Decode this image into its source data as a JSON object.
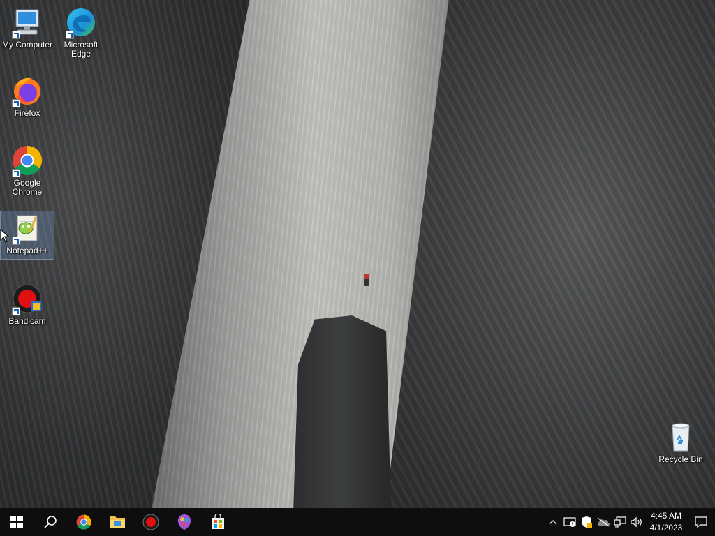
{
  "desktop": {
    "icons": [
      {
        "label": "My Computer"
      },
      {
        "label": "Microsoft Edge"
      },
      {
        "label": "Firefox"
      },
      {
        "label": "Google Chrome"
      },
      {
        "label": "Notepad++"
      },
      {
        "label": "Bandicam"
      },
      {
        "label": "Recycle Bin"
      }
    ]
  },
  "taskbar": {
    "start_icon": "windows-start-icon",
    "pinned": [
      {
        "name": "search-icon"
      },
      {
        "name": "chrome-icon"
      },
      {
        "name": "file-explorer-icon"
      },
      {
        "name": "bandicam-icon"
      },
      {
        "name": "paint-icon"
      },
      {
        "name": "store-icon"
      }
    ],
    "tray": {
      "icons": [
        "chevron-up-icon",
        "security-icon",
        "defender-icon",
        "onedrive-icon",
        "network-icon",
        "volume-icon"
      ],
      "time": "4:45 AM",
      "date": "4/1/2023",
      "notification_icon": "action-center-icon"
    }
  },
  "colors": {
    "taskbar_bg": "#0e0e0e",
    "selection": "#78a0dc"
  }
}
